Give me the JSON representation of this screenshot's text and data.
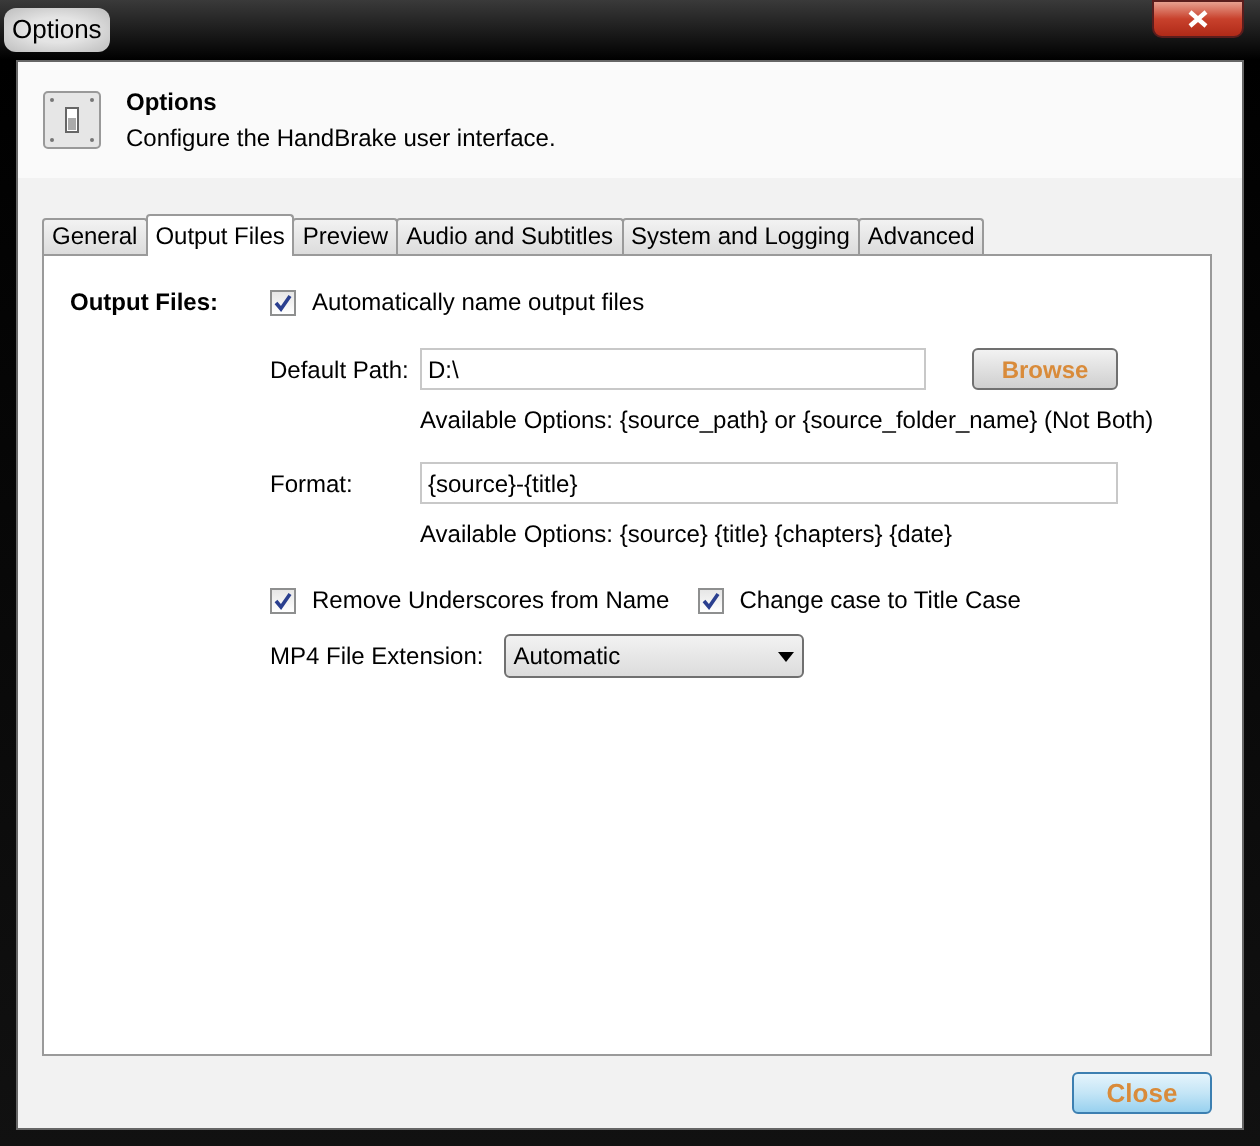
{
  "window": {
    "title": "Options"
  },
  "header": {
    "title": "Options",
    "subtitle": "Configure the HandBrake user interface."
  },
  "tabs": [
    {
      "label": "General",
      "selected": false
    },
    {
      "label": "Output Files",
      "selected": true
    },
    {
      "label": "Preview",
      "selected": false
    },
    {
      "label": "Audio and Subtitles",
      "selected": false
    },
    {
      "label": "System and Logging",
      "selected": false
    },
    {
      "label": "Advanced",
      "selected": false
    }
  ],
  "section_label": "Output Files:",
  "auto_name": {
    "label": "Automatically name output files",
    "checked": true
  },
  "default_path": {
    "label": "Default Path:",
    "value": "D:\\",
    "button": "Browse",
    "hint": "Available Options: {source_path} or {source_folder_name} (Not Both)"
  },
  "format": {
    "label": "Format:",
    "value": "{source}-{title}",
    "hint": "Available Options: {source} {title} {chapters} {date}"
  },
  "options": [
    {
      "label": "Remove Underscores from Name",
      "checked": true
    },
    {
      "label": "Change case to Title Case",
      "checked": true
    }
  ],
  "mp4_extension": {
    "label": "MP4 File Extension:",
    "value": "Automatic"
  },
  "buttons": [
    "Close"
  ]
}
